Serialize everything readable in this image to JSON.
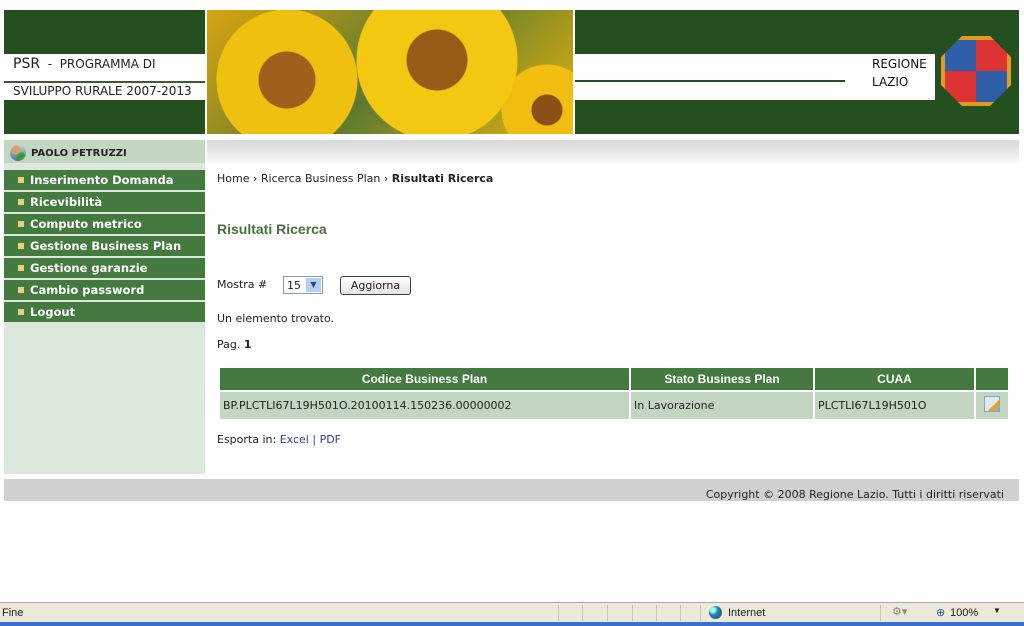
{
  "header": {
    "psr": "PSR",
    "dash": "-",
    "line1": "PROGRAMMA DI",
    "line2": "SVILUPPO RURALE 2007-2013",
    "region1": "REGIONE",
    "region2": "LAZIO"
  },
  "sidebar": {
    "user": "PAOLO PETRUZZI",
    "items": [
      {
        "label": "Inserimento Domanda"
      },
      {
        "label": "Ricevibilità"
      },
      {
        "label": "Computo metrico"
      },
      {
        "label": "Gestione Business Plan"
      },
      {
        "label": "Gestione garanzie"
      },
      {
        "label": "Cambio password"
      },
      {
        "label": "Logout"
      }
    ]
  },
  "breadcrumb": {
    "home": "Home",
    "sep": "›",
    "search": "Ricerca Business Plan",
    "current": "Risultati Ricerca"
  },
  "main": {
    "title": "Risultati Ricerca",
    "show_label": "Mostra #",
    "show_value": "15",
    "refresh": "Aggiorna",
    "found": "Un elemento trovato.",
    "page_label": "Pag.",
    "page": "1",
    "table": {
      "headers": [
        "Codice Business Plan",
        "Stato Business Plan",
        "CUAA",
        ""
      ],
      "rows": [
        [
          "BP.PLCTLI67L19H501O.20100114.150236.00000002",
          "In Lavorazione",
          "PLCTLI67L19H501O"
        ]
      ]
    },
    "export_label": "Esporta in:",
    "excel": "Excel",
    "sep": "|",
    "pdf": "PDF"
  },
  "footer": {
    "copyright": "Copyright © 2008 Regione Lazio. Tutti i diritti riservati"
  },
  "statusbar": {
    "status": "Fine",
    "zone": "Internet",
    "zoom": "100%"
  },
  "colors": {
    "dark_green": "#245020",
    "menu_green": "#447a3f",
    "light_green": "#c3d6c1"
  }
}
